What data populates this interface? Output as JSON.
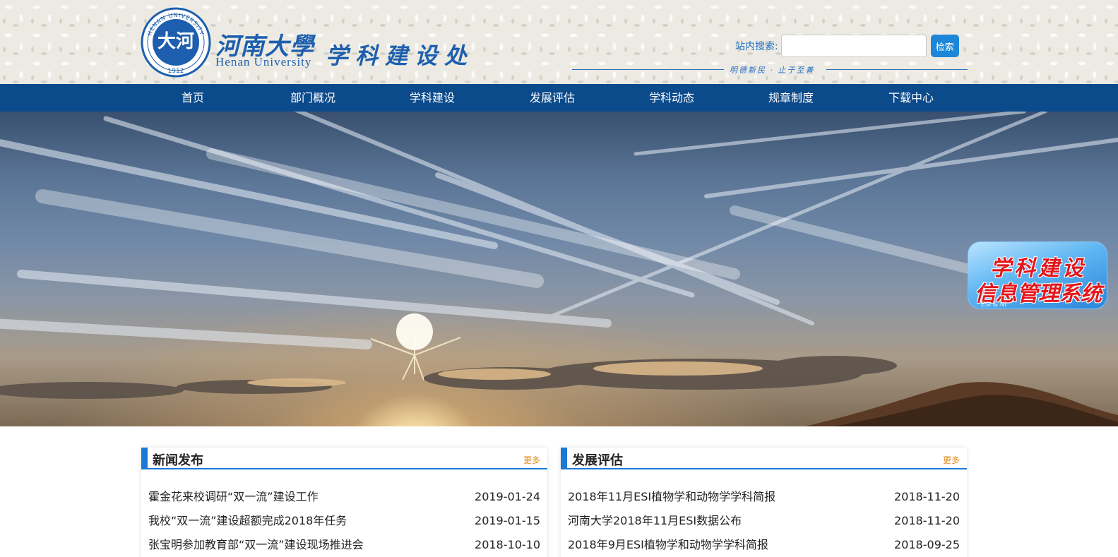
{
  "header": {
    "logo_cn": "河南大學",
    "logo_en": "Henan University",
    "seal_text": "HENAN UNIVERSITY",
    "seal_year": "1912",
    "dept_name": "学科建设处",
    "motto": "明德新民 · 止于至善",
    "search_label": "站内搜索:",
    "search_value": "",
    "search_button": "检索"
  },
  "nav": {
    "items": [
      {
        "label": "首页"
      },
      {
        "label": "部门概况"
      },
      {
        "label": "学科建设"
      },
      {
        "label": "发展评估"
      },
      {
        "label": "学科动态"
      },
      {
        "label": "规章制度"
      },
      {
        "label": "下载中心"
      }
    ]
  },
  "banner": {
    "badge_line1": "学科建设",
    "badge_line2": "信息管理系统",
    "badge_sub": "ESI & NI"
  },
  "news": {
    "title": "新闻发布",
    "more": "更多",
    "items": [
      {
        "title": "霍金花来校调研“双一流”建设工作",
        "date": "2019-01-24"
      },
      {
        "title": "我校“双一流”建设超额完成2018年任务",
        "date": "2019-01-15"
      },
      {
        "title": "张宝明参加教育部“双一流”建设现场推进会",
        "date": "2018-10-10"
      }
    ]
  },
  "evaluation": {
    "title": "发展评估",
    "more": "更多",
    "items": [
      {
        "title": "2018年11月ESI植物学和动物学学科简报",
        "date": "2018-11-20"
      },
      {
        "title": "河南大学2018年11月ESI数据公布",
        "date": "2018-11-20"
      },
      {
        "title": "2018年9月ESI植物学和动物学学科简报",
        "date": "2018-09-25"
      }
    ]
  },
  "colors": {
    "brand_blue": "#1d5fae",
    "nav_bg": "#0b4a8b",
    "accent": "#1c7ad6",
    "more_orange": "#e58a1a",
    "badge_red": "#e4151b"
  },
  "icons": {
    "seal": "university-seal-icon",
    "badge": "system-badge-icon"
  }
}
